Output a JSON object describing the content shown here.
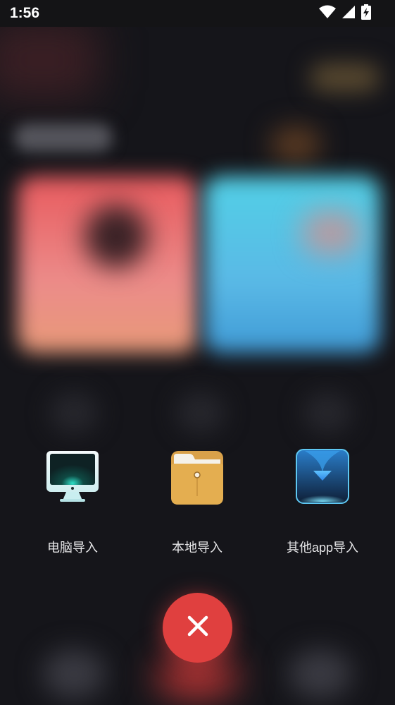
{
  "status_bar": {
    "time": "1:56"
  },
  "import_options": [
    {
      "label": "电脑导入",
      "icon": "computer-monitor-icon"
    },
    {
      "label": "本地导入",
      "icon": "folder-icon"
    },
    {
      "label": "其他app导入",
      "icon": "download-arrow-icon"
    }
  ],
  "close_button": {
    "icon": "close-icon",
    "color": "#e0403f"
  }
}
